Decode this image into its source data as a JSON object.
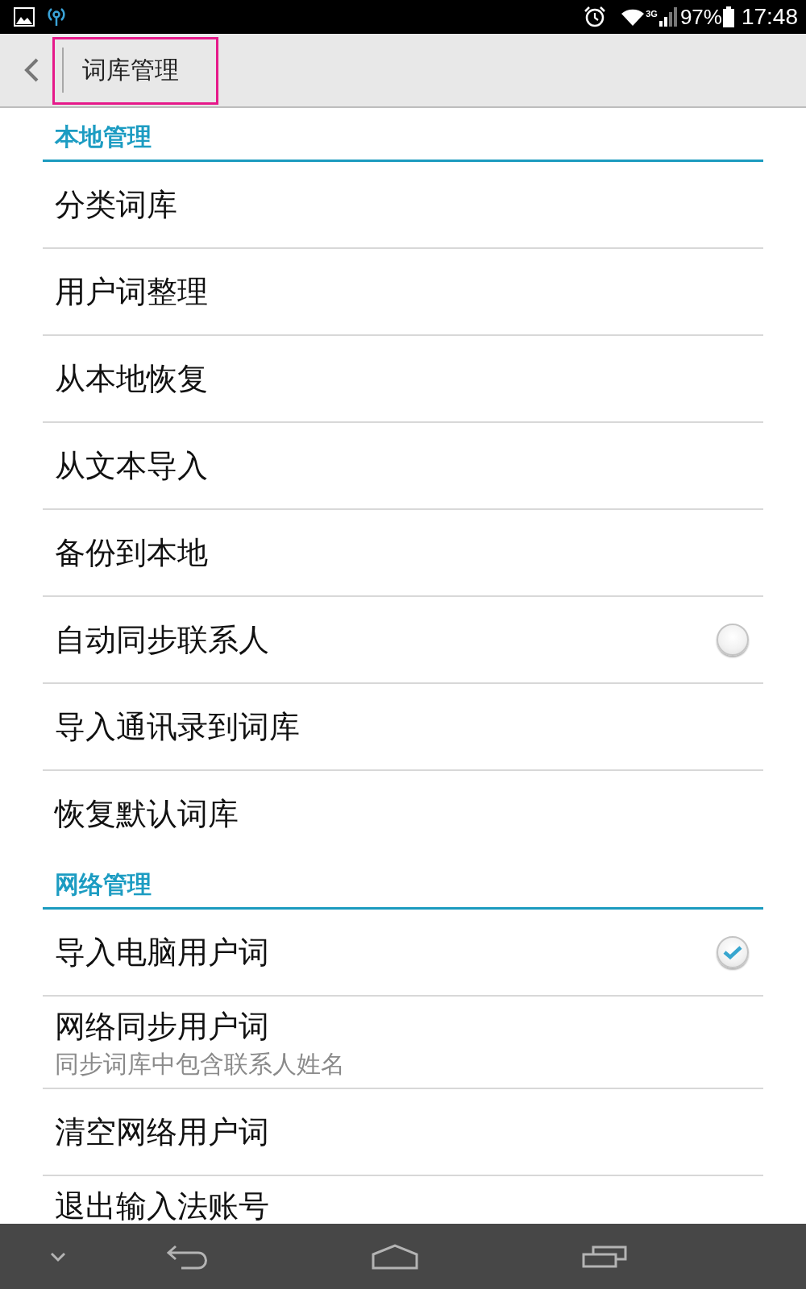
{
  "status_bar": {
    "network_type": "3G",
    "battery": "97%",
    "time": "17:48"
  },
  "header": {
    "title": "词库管理",
    "highlighted": true
  },
  "sections": [
    {
      "title": "本地管理",
      "items": [
        {
          "kind": "item",
          "label": "分类词库"
        },
        {
          "kind": "item",
          "label": "用户词整理"
        },
        {
          "kind": "item",
          "label": "从本地恢复"
        },
        {
          "kind": "item",
          "label": "从文本导入"
        },
        {
          "kind": "item",
          "label": "备份到本地"
        },
        {
          "kind": "checkbox",
          "label": "自动同步联系人",
          "checked": false
        },
        {
          "kind": "item",
          "label": "导入通讯录到词库"
        },
        {
          "kind": "item",
          "label": "恢复默认词库"
        }
      ]
    },
    {
      "title": "网络管理",
      "items": [
        {
          "kind": "checkbox",
          "label": "导入电脑用户词",
          "checked": true
        },
        {
          "kind": "item",
          "label": "网络同步用户词",
          "summary": "同步词库中包含联系人姓名"
        },
        {
          "kind": "item",
          "label": "清空网络用户词"
        },
        {
          "kind": "item",
          "label": "退出输入法账号"
        }
      ]
    }
  ]
}
